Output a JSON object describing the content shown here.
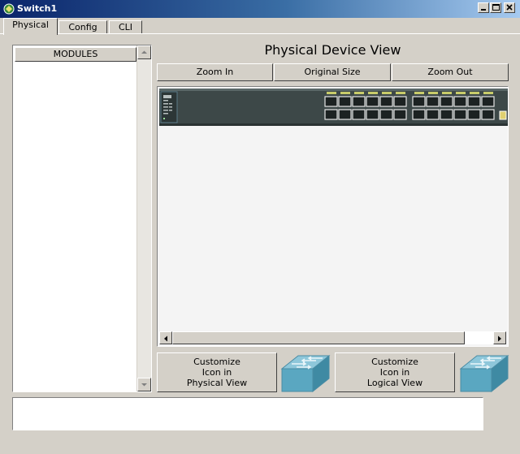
{
  "window": {
    "title": "Switch1"
  },
  "tabs": [
    {
      "label": "Physical",
      "active": true
    },
    {
      "label": "Config",
      "active": false
    },
    {
      "label": "CLI",
      "active": false
    }
  ],
  "modules_panel": {
    "header": "MODULES"
  },
  "device_view": {
    "heading": "Physical Device View",
    "zoom_in_label": "Zoom In",
    "original_size_label": "Original Size",
    "zoom_out_label": "Zoom Out"
  },
  "customize": {
    "physical": {
      "line1": "Customize",
      "line2": "Icon in",
      "line3": "Physical View"
    },
    "logical": {
      "line1": "Customize",
      "line2": "Icon in",
      "line3": "Logical View"
    }
  },
  "colors": {
    "title_bar_start": "#0a246a",
    "title_bar_end": "#a6caf0",
    "switch_body": "#3d4848",
    "switch_port_led": "#c8cc6a",
    "switch_icon_teal": "#5aa7c1"
  },
  "icons": [
    "app-icon",
    "minimize-icon",
    "maximize-icon",
    "close-icon",
    "scroll-up-arrow-icon",
    "scroll-down-arrow-icon",
    "scroll-left-arrow-icon",
    "scroll-right-arrow-icon",
    "switch-icon"
  ]
}
